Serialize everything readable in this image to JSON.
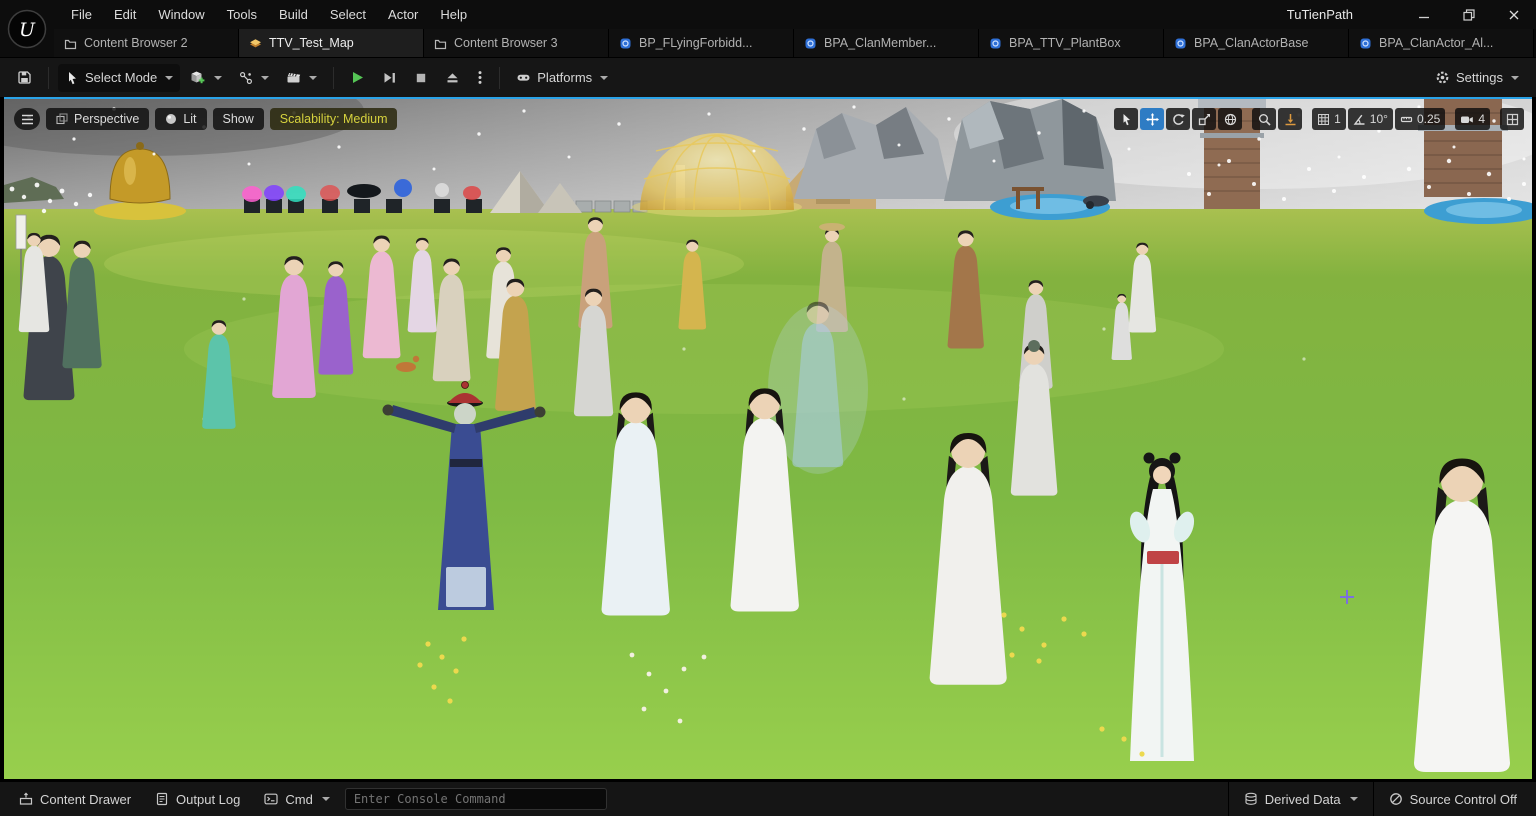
{
  "window": {
    "title": "TuTienPath",
    "menu": [
      "File",
      "Edit",
      "Window",
      "Tools",
      "Build",
      "Select",
      "Actor",
      "Help"
    ]
  },
  "tabs": [
    {
      "label": "Content Browser 2",
      "type": "content-browser",
      "active": false
    },
    {
      "label": "TTV_Test_Map",
      "type": "map",
      "active": true
    },
    {
      "label": "Content Browser 3",
      "type": "content-browser",
      "active": false
    },
    {
      "label": "BP_FLyingForbidd...",
      "type": "blueprint",
      "active": false
    },
    {
      "label": "BPA_ClanMember...",
      "type": "blueprint",
      "active": false
    },
    {
      "label": "BPA_TTV_PlantBox",
      "type": "blueprint",
      "active": false
    },
    {
      "label": "BPA_ClanActorBase",
      "type": "blueprint",
      "active": false
    },
    {
      "label": "BPA_ClanActor_Al...",
      "type": "blueprint",
      "active": false
    }
  ],
  "toolbar": {
    "select_mode": "Select Mode",
    "platforms": "Platforms",
    "settings": "Settings"
  },
  "viewport": {
    "view_mode": "Perspective",
    "lighting": "Lit",
    "show": "Show",
    "scalability": "Scalability: Medium",
    "snap": {
      "grid": "1",
      "rotation": "10°",
      "scale": "0.25",
      "camera_speed": "4"
    }
  },
  "statusbar": {
    "content_drawer": "Content Drawer",
    "output_log": "Output Log",
    "cmd": "Cmd",
    "console_placeholder": "Enter Console Command",
    "derived_data": "Derived Data",
    "source_control": "Source Control Off"
  },
  "colors": {
    "viewport_focus_blue": "#2aa3e8",
    "active_tool_blue": "#2e7cc4",
    "play_green": "#55c455",
    "scalability_yellow": "#d6d23e",
    "blueprint_tab_blue": "#2e6fd6",
    "map_tab_orange": "#e2a33c"
  },
  "icons": {
    "unreal-logo": "black circle with white U",
    "save-icon": "floppy disk",
    "cursor-icon": "arrow pointer",
    "add-cube-icon": "cube with green plus",
    "blueprint-icon": "linked nodes",
    "cinematics-icon": "clapperboard",
    "play-icon": "green triangle",
    "frame-skip-icon": "triangle with bar",
    "stop-icon": "square",
    "eject-icon": "triangle over bar",
    "gamepad-icon": "game controller",
    "gear-icon": "cog",
    "move-tool-icon": "four-way arrows",
    "rotate-tool-icon": "circular arrow",
    "scale-tool-icon": "box with diagonal arrow",
    "globe-icon": "sphere with meridians",
    "magnifier-icon": "magnifying glass",
    "surface-snap-icon": "orange arrow onto surface",
    "grid-snap-icon": "grid",
    "angle-snap-icon": "angle with arc",
    "scale-snap-icon": "ruler",
    "camera-icon": "camera",
    "quad-view-icon": "four panes",
    "content-drawer-icon": "drawer with up arrow",
    "output-log-icon": "document with lines",
    "cmd-icon": "console prompt",
    "derived-data-icon": "database stack",
    "source-control-off-icon": "circle with slash"
  }
}
